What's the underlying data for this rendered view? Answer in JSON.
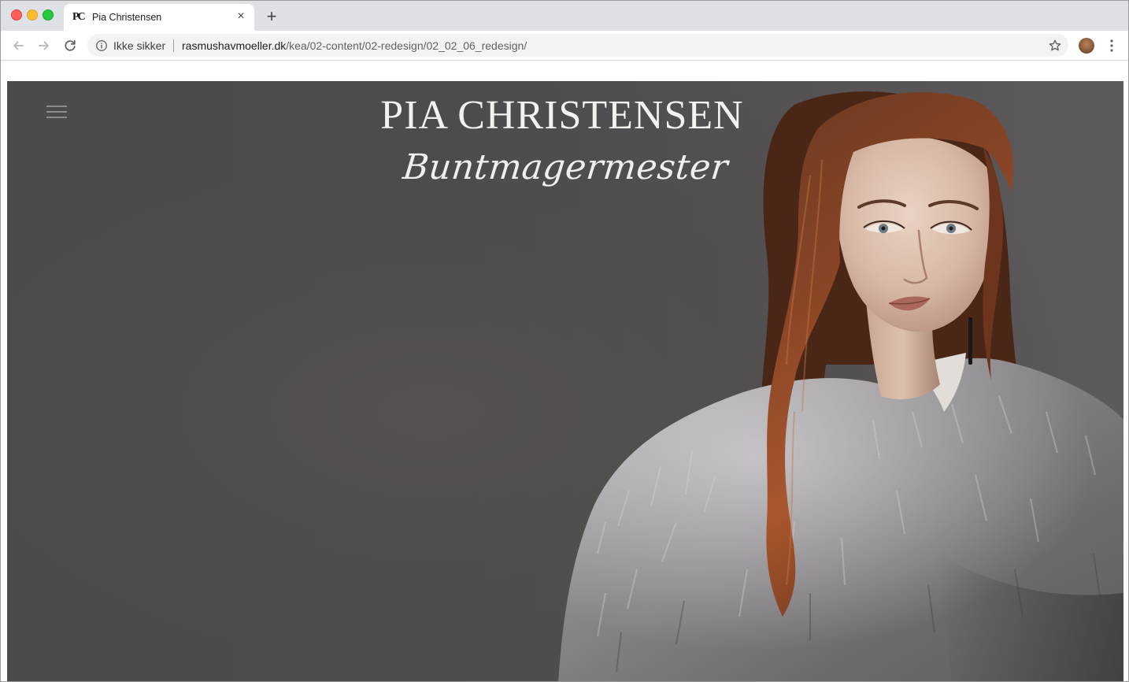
{
  "browser": {
    "tab": {
      "favicon_text": "PC",
      "title": "Pia Christensen",
      "close_symbol": "×"
    },
    "new_tab_symbol": "+",
    "toolbar": {
      "back_icon": "arrow-left-icon",
      "forward_icon": "arrow-right-icon",
      "reload_icon": "reload-icon",
      "security_label": "Ikke sikker",
      "url_host": "rasmushavmoeller.dk",
      "url_path": "/kea/02-content/02-redesign/02_02_06_redesign/",
      "bookmark_icon": "star-icon",
      "menu_icon": "kebab-menu-icon"
    }
  },
  "page": {
    "menu_icon": "hamburger-icon",
    "brand_name": "PIA CHRISTENSEN",
    "brand_tagline": "Buntmagermester",
    "hero_image": "model-in-grey-fur-coat"
  },
  "colors": {
    "hero_background": "#4e4b4d",
    "brand_text": "#f4f1ef",
    "tab_strip": "#dee1e6"
  }
}
